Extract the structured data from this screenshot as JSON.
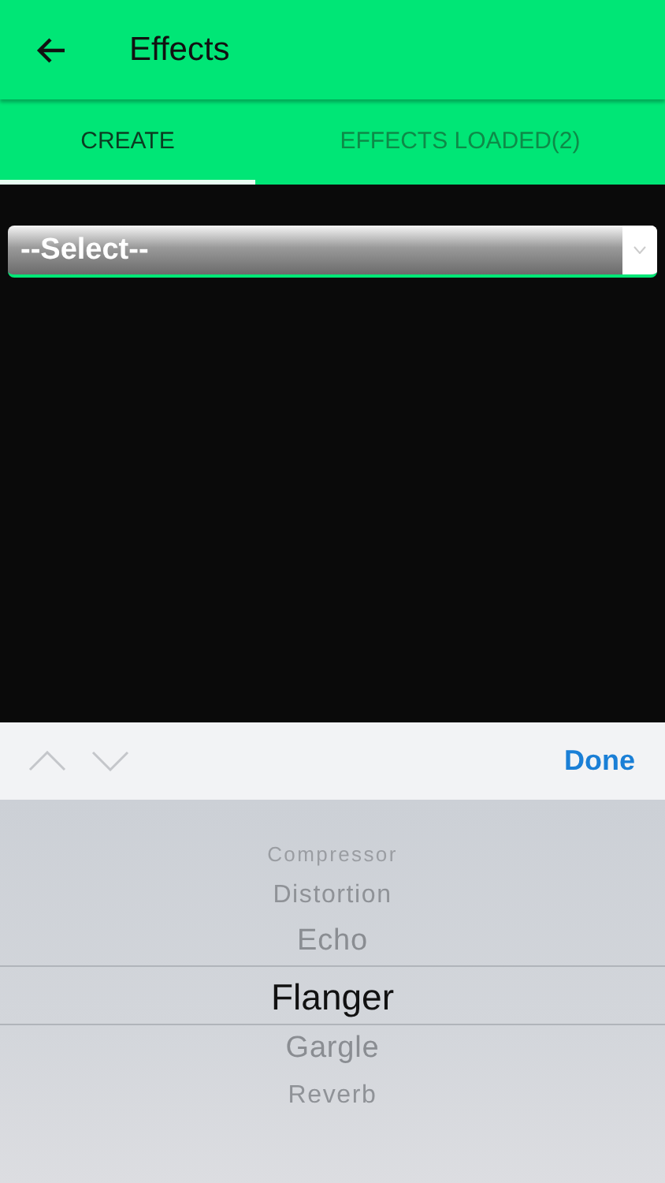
{
  "header": {
    "title": "Effects"
  },
  "tabs": [
    {
      "label": "CREATE",
      "selected": true
    },
    {
      "label": "EFFECTS LOADED(2)",
      "selected": false
    }
  ],
  "dropdown": {
    "value": "--Select--"
  },
  "picker_toolbar": {
    "done": "Done"
  },
  "picker": [
    {
      "label": "Compressor",
      "selected": false
    },
    {
      "label": "Distortion",
      "selected": false
    },
    {
      "label": "Echo",
      "selected": false
    },
    {
      "label": "Flanger",
      "selected": true
    },
    {
      "label": "Gargle",
      "selected": false
    },
    {
      "label": "Reverb",
      "selected": false
    }
  ]
}
